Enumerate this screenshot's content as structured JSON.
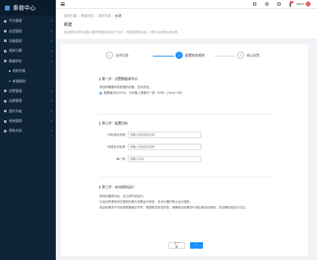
{
  "sidebar": {
    "brand_title": "秦普中心",
    "items": [
      {
        "label": "平台管理",
        "sub": false
      },
      {
        "label": "应用管理",
        "sub": false
      },
      {
        "label": "设备管理",
        "sub": false
      },
      {
        "label": "规则引擎",
        "sub": false
      },
      {
        "label": "数据转发",
        "sub": false
      },
      {
        "label": "规则列表",
        "sub": true
      },
      {
        "label": "新建规则",
        "sub": true
      },
      {
        "label": "告警管理",
        "sub": false
      },
      {
        "label": "运维管理",
        "sub": false
      },
      {
        "label": "固件升级",
        "sub": false
      },
      {
        "label": "系统管理",
        "sub": false
      },
      {
        "label": "帮助文档",
        "sub": false
      }
    ]
  },
  "header": {
    "notification_count": "12",
    "username": "admin"
  },
  "page": {
    "breadcrumb": [
      "规则引擎",
      "数据转发",
      "规则列表",
      "新建"
    ],
    "title": "新建",
    "description": "通过规则引擎将设备上报的数据转发到云产品中，完成数据的存储、计算与应用等后续处理。"
  },
  "steps": [
    {
      "num": "1",
      "label": "选择设备"
    },
    {
      "num": "2",
      "label": "配置转发规则"
    },
    {
      "num": "3",
      "label": "确认配置"
    }
  ],
  "section1": {
    "title": "第一步：设置数据源节点",
    "text": "请选择需要转发数据的设备，支持多选。",
    "option": "数据格式为JSON，与设备上报格式一致（示例：{\"temp\":25}）"
  },
  "section2": {
    "title": "第二步：配置目标",
    "fields": [
      {
        "label": "*目标地址名称",
        "placeholder": "请输入目标地址名称"
      },
      {
        "label": "*消息队列名称",
        "placeholder": "请输入消息队列名称"
      },
      {
        "label": "*每一条",
        "placeholder": "请输入内容"
      }
    ]
  },
  "section3": {
    "title": "第三步：启动规则运行",
    "lines": [
      "规则创建成功后，会立即开始运行。",
      "已启动的规则可在规则列表中查看运行状态，也可以随时停止运行规则。",
      "若目标服务不可用或数据格式不符，数据转发将会失败，请确保目标服务可用后再启动规则，并定期检查运行日志。"
    ]
  },
  "buttons": {
    "prev": "上一步",
    "next": "下一步"
  }
}
